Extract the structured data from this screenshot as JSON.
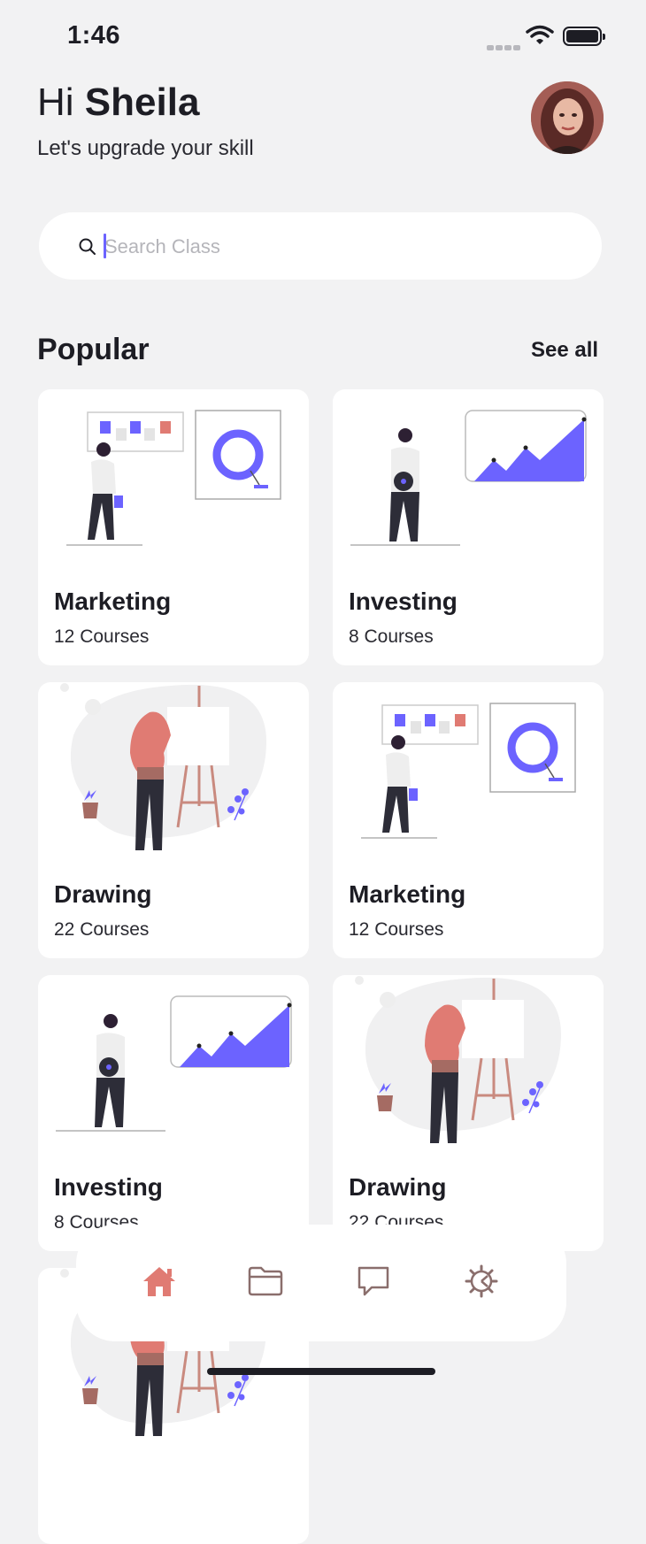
{
  "status": {
    "time": "1:46"
  },
  "header": {
    "greeting": "Hi",
    "name": "Sheila",
    "subtitle": "Let's upgrade your skill"
  },
  "search": {
    "placeholder": "Search Class",
    "value": ""
  },
  "section": {
    "title": "Popular",
    "see_all": "See all"
  },
  "cards": [
    {
      "title": "Marketing",
      "count": "12 Courses",
      "illustration": "marketing"
    },
    {
      "title": "Investing",
      "count": "8 Courses",
      "illustration": "investing"
    },
    {
      "title": "Drawing",
      "count": "22 Courses",
      "illustration": "drawing"
    },
    {
      "title": "Marketing",
      "count": "12 Courses",
      "illustration": "marketing"
    },
    {
      "title": "Investing",
      "count": "8 Courses",
      "illustration": "investing"
    },
    {
      "title": "Drawing",
      "count": "22 Courses",
      "illustration": "drawing"
    },
    {
      "title": "",
      "count": "",
      "illustration": "drawing"
    }
  ],
  "tabbar": {
    "items": [
      {
        "icon": "home-icon",
        "active": true
      },
      {
        "icon": "folder-icon",
        "active": false
      },
      {
        "icon": "chat-icon",
        "active": false
      },
      {
        "icon": "settings-icon",
        "active": false
      }
    ]
  },
  "colors": {
    "accent": "#6c63ff",
    "active_tab": "#e07b73",
    "icon": "#8a6e6c",
    "background": "#f2f2f3"
  }
}
